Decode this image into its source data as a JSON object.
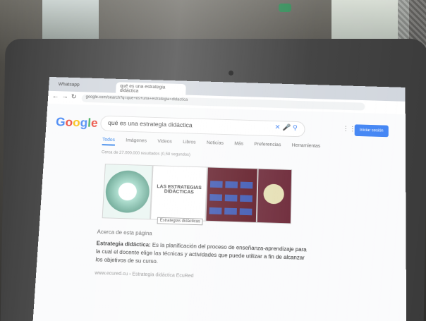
{
  "browser": {
    "tabs": [
      "Whatsapp",
      "qué es una estrategia didáctica"
    ],
    "url": "google.com/search?q=que+es+una+estrategia+didactica"
  },
  "google": {
    "logo": "Google",
    "query": "qué es una estrategia didáctica",
    "signin_label": "Iniciar sesión",
    "tabs": [
      "Todos",
      "Imágenes",
      "Videos",
      "Libros",
      "Noticias",
      "Más",
      "Preferencias",
      "Herramientas"
    ],
    "result_count": "Cerca de 27.000.000 resultados (0,58 segundos)",
    "image_title": "LAS ESTRATEGIAS DIDÁCTICAS",
    "tooltip": "Estrategias didácticas",
    "about_label": "Acerca de esta página",
    "snippet_term": "Estrategia didáctica:",
    "snippet_text": "Es la planificación del proceso de enseñanza-aprendizaje para la cual el docente elige las técnicas y actividades que puede utilizar a fin de alcanzar los objetivos de su curso.",
    "footer": "www.ecured.cu › Estrategia didáctica   EcuRed"
  },
  "colors": {
    "google_blue": "#4285F4",
    "google_red": "#EA4335",
    "google_yellow": "#FBBC05",
    "google_green": "#34A853"
  }
}
